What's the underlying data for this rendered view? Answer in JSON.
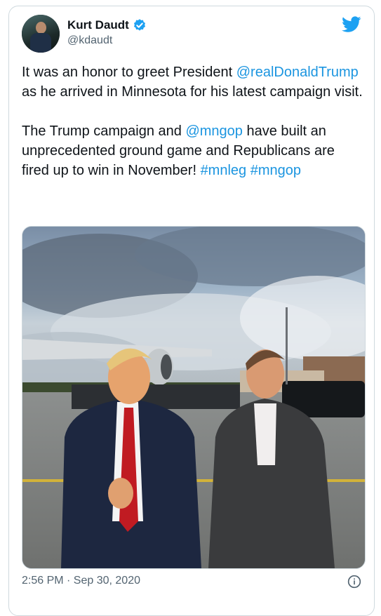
{
  "tweet": {
    "author_name": "Kurt Daudt",
    "author_handle": "@kdaudt",
    "verified": true,
    "paragraphs": [
      [
        {
          "text": "It was an honor to greet President "
        },
        {
          "text": "@realDonaldTrump",
          "link": true
        },
        {
          "text": " as he arrived in Minnesota for his latest campaign visit."
        }
      ],
      [
        {
          "text": "The Trump campaign and "
        },
        {
          "text": "@mngop",
          "link": true
        },
        {
          "text": " have built an unprecedented ground game and Republicans are fired up to win in November! "
        },
        {
          "text": "#mnleg",
          "link": true
        },
        {
          "text": " "
        },
        {
          "text": "#mngop",
          "link": true
        }
      ]
    ],
    "timestamp": "2:56 PM · Sep 30, 2020"
  },
  "icons": {
    "brand": "twitter-bird-icon",
    "verified": "verified-badge-icon",
    "info": "info-icon"
  },
  "colors": {
    "link": "#1b95e0",
    "brand": "#1da1f2",
    "text": "#0f1419",
    "muted": "#536471",
    "border": "#cfd9de"
  }
}
